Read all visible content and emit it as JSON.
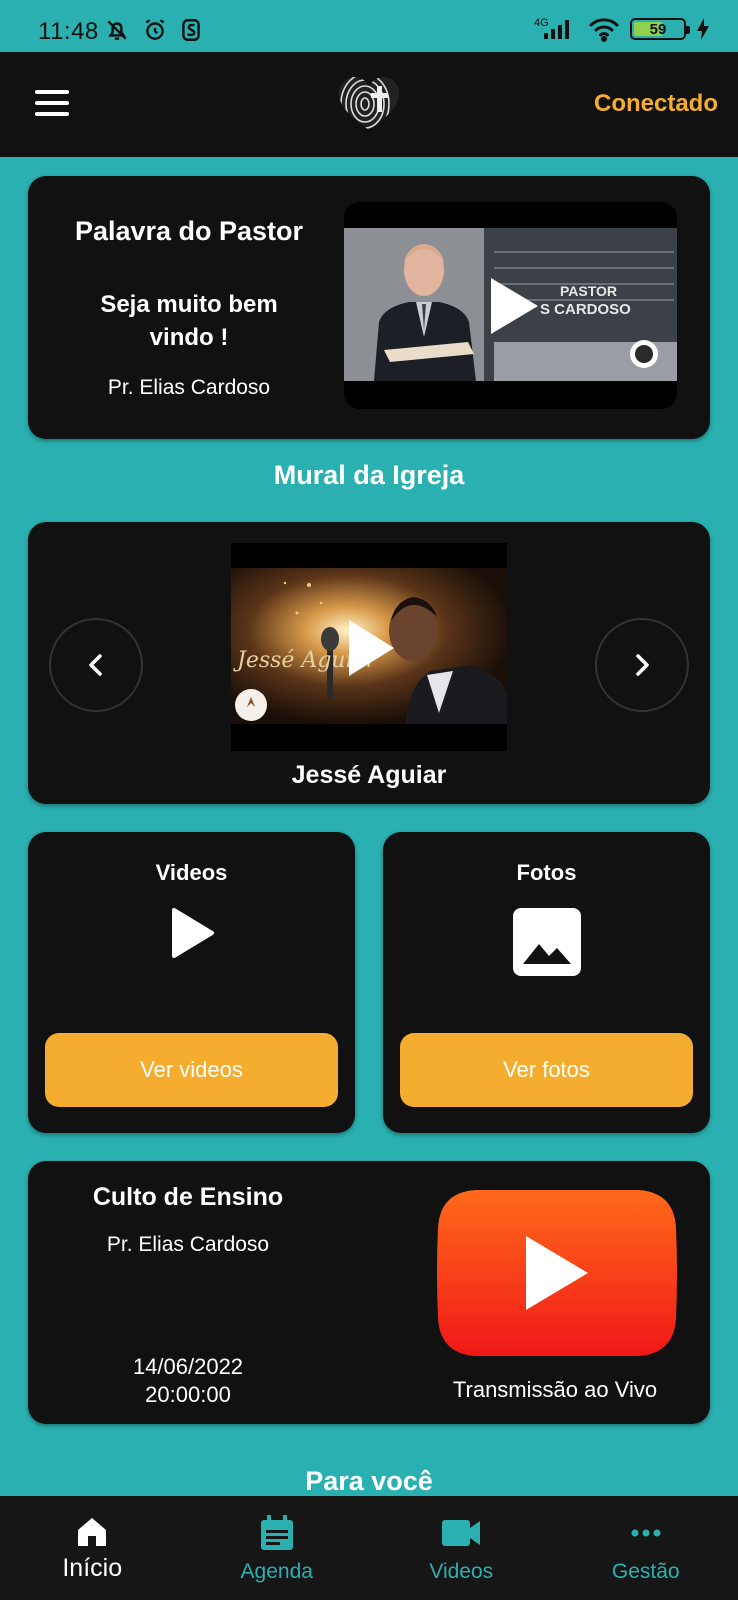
{
  "status_bar": {
    "time": "11:48",
    "network": "4G",
    "battery_percent": 59,
    "battery_label": "59"
  },
  "header": {
    "menu_icon": "hamburger-menu-icon",
    "logo": "fingerprint-heart-cross-logo",
    "connection_status": "Conectado"
  },
  "pastor_card": {
    "title": "Palavra do Pastor",
    "subtitle": "Seja muito bem vindo !",
    "pastor_name": "Pr. Elias Cardoso",
    "video_thumbnail_text_1": "PASTOR",
    "video_thumbnail_text_2": "S CARDOSO"
  },
  "mural": {
    "section_title": "Mural da Igreja",
    "caption": "Jessé Aguiar",
    "thumbnail_script": "Jessé Aguiar",
    "prev_icon": "chevron-left-icon",
    "next_icon": "chevron-right-icon"
  },
  "tiles": {
    "videos": {
      "title": "Videos",
      "button_label": "Ver videos",
      "icon": "play-icon"
    },
    "photos": {
      "title": "Fotos",
      "button_label": "Ver fotos",
      "icon": "image-icon"
    }
  },
  "live": {
    "title": "Culto de Ensino",
    "pastor": "Pr. Elias Cardoso",
    "date": "14/06/2022",
    "time": "20:00:00",
    "label": "Transmissão ao Vivo"
  },
  "for_you": {
    "section_title": "Para você"
  },
  "bottom_nav": {
    "items": [
      {
        "label": "Início",
        "icon": "home-icon",
        "active": true
      },
      {
        "label": "Agenda",
        "icon": "calendar-icon",
        "active": false
      },
      {
        "label": "Videos",
        "icon": "video-camera-icon",
        "active": false
      },
      {
        "label": "Gestão",
        "icon": "more-dots-icon",
        "active": false
      }
    ]
  },
  "colors": {
    "background": "#2ab0b0",
    "card": "#111111",
    "accent": "#f5ad2f",
    "live_red": "#f5331f"
  }
}
